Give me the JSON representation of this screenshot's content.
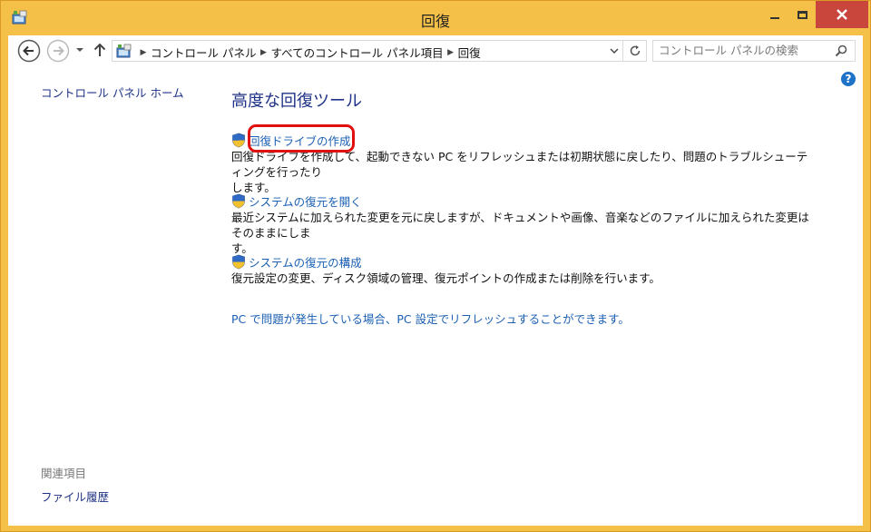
{
  "window": {
    "title": "回復"
  },
  "nav": {
    "breadcrumbs": [
      "コントロール パネル",
      "すべてのコントロール パネル項目",
      "回復"
    ],
    "search_placeholder": "コントロール パネルの検索"
  },
  "sidebar": {
    "home": "コントロール パネル ホーム",
    "related_heading": "関連項目",
    "related_items": [
      "ファイル履歴"
    ]
  },
  "main": {
    "heading": "高度な回復ツール",
    "items": [
      {
        "title": "回復ドライブの作成",
        "desc_line1": "回復ドライブを作成して、起動できない PC をリフレッシュまたは初期状態に戻したり、問題のトラブルシューティングを行ったり",
        "desc_line2": "します。",
        "highlighted": true
      },
      {
        "title": "システムの復元を開く",
        "desc_line1": "最近システムに加えられた変更を元に戻しますが、ドキュメントや画像、音楽などのファイルに加えられた変更はそのままにしま",
        "desc_line2": "す。"
      },
      {
        "title": "システムの復元の構成",
        "desc_line1": "復元設定の変更、ディスク領域の管理、復元ポイントの作成または削除を行います。",
        "desc_line2": ""
      }
    ],
    "refresh_link": "PC で問題が発生している場合、PC 設定でリフレッシュすることができます。"
  },
  "colors": {
    "window_frame": "#f4c048",
    "close_button": "#c9463d",
    "link": "#1a5fb4",
    "heading": "#1e3287",
    "highlight": "#e01010"
  }
}
